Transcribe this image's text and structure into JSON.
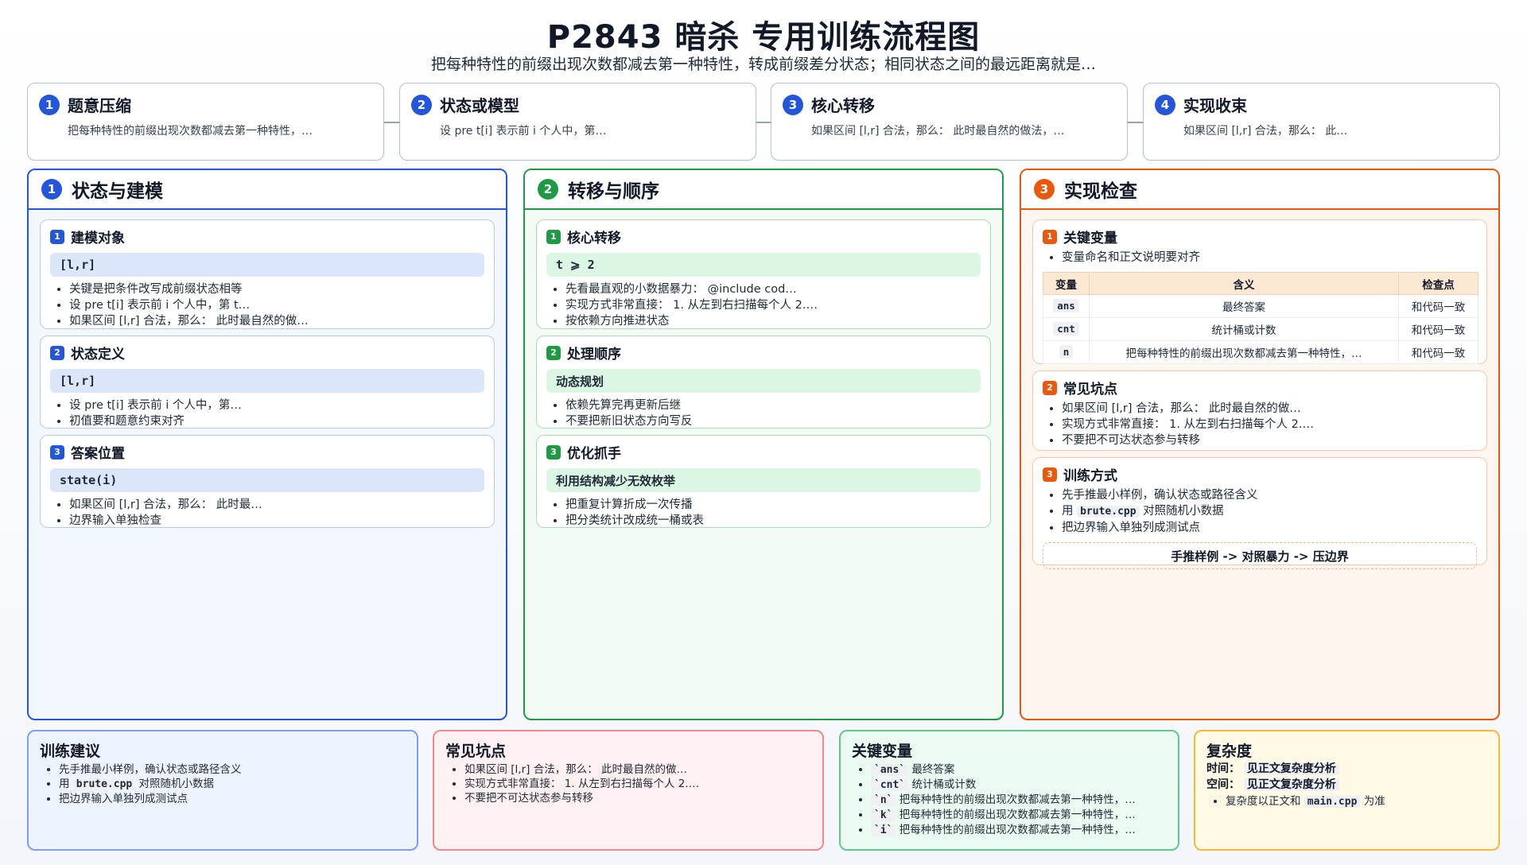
{
  "header": {
    "title": "P2843 暗杀 专用训练流程图",
    "subtitle": "把每种特性的前缀出现次数都减去第一种特性，转成前缀差分状态；相同状态之间的最远距离就是…"
  },
  "flow": [
    {
      "num": "1",
      "title": "题意压缩",
      "desc": "把每种特性的前缀出现次数都减去第一种特性，…"
    },
    {
      "num": "2",
      "title": "状态或模型",
      "desc": "设 pre t[i] 表示前 i 个人中，第…"
    },
    {
      "num": "3",
      "title": "核心转移",
      "desc": "如果区间 [l,r] 合法，那么：  此时最自然的做法，…"
    },
    {
      "num": "4",
      "title": "实现收束",
      "desc": "如果区间 [l,r] 合法，那么：  此…"
    }
  ],
  "columns": {
    "c1": {
      "num": "1",
      "title": "状态与建模",
      "s1": {
        "num": "1",
        "title": "建模对象",
        "pill": "[l,r]",
        "bullets": [
          "关键是把条件改写成前缀状态相等",
          "设 pre t[i] 表示前 i 个人中，第 t…",
          "如果区间 [l,r] 合法，那么：  此时最自然的做…"
        ]
      },
      "s2": {
        "num": "2",
        "title": "状态定义",
        "pill": "[l,r]",
        "bullets": [
          "设 pre t[i] 表示前 i 个人中，第…",
          "初值要和题意约束对齐"
        ]
      },
      "s3": {
        "num": "3",
        "title": "答案位置",
        "pill": "state(i)",
        "bullets": [
          "如果区间 [l,r] 合法，那么：  此时最…",
          "边界输入单独检查"
        ]
      }
    },
    "c2": {
      "num": "2",
      "title": "转移与顺序",
      "s1": {
        "num": "1",
        "title": "核心转移",
        "pill": "t ⩾ 2",
        "bullets": [
          "先看最直观的小数据暴力：  @include cod…",
          "实现方式非常直接：  1. 从左到右扫描每个人 2.…",
          "按依赖方向推进状态"
        ]
      },
      "s2": {
        "num": "2",
        "title": "处理顺序",
        "pill": "动态规划",
        "bullets": [
          "依赖先算完再更新后继",
          "不要把新旧状态方向写反"
        ]
      },
      "s3": {
        "num": "3",
        "title": "优化抓手",
        "pill": "利用结构减少无效枚举",
        "bullets": [
          "把重复计算折成一次传播",
          "把分类统计改成统一桶或表"
        ]
      }
    },
    "c3": {
      "num": "3",
      "title": "实现检查",
      "s1": {
        "num": "1",
        "title": "关键变量",
        "note": "变量命名和正文说明要对齐",
        "table": {
          "headers": [
            "变量",
            "含义",
            "检查点"
          ],
          "rows": [
            [
              "ans",
              "最终答案",
              "和代码一致"
            ],
            [
              "cnt",
              "统计桶或计数",
              "和代码一致"
            ],
            [
              "n",
              "把每种特性的前缀出现次数都减去第一种特性，…",
              "和代码一致"
            ]
          ]
        }
      },
      "s2": {
        "num": "2",
        "title": "常见坑点",
        "bullets": [
          "如果区间 [l,r] 合法，那么：  此时最自然的做…",
          "实现方式非常直接：  1. 从左到右扫描每个人 2.…",
          "不要把不可达状态参与转移"
        ]
      },
      "s3": {
        "num": "3",
        "title": "训练方式",
        "b1": "先手推最小样例，确认状态或路径含义",
        "b2_pre": "用 ",
        "b2_code": "brute.cpp",
        "b2_post": " 对照随机小数据",
        "b3": "把边界输入单独列成测试点",
        "flow_hint": "手推样例 -> 对照暴力 -> 压边界"
      }
    }
  },
  "bottom": {
    "advice": {
      "title": "训练建议",
      "b1": "先手推最小样例，确认状态或路径含义",
      "b2_pre": "用 ",
      "b2_code": "brute.cpp",
      "b2_post": " 对照随机小数据",
      "b3": "把边界输入单独列成测试点"
    },
    "pitfalls": {
      "title": "常见坑点",
      "bullets": [
        "如果区间 [l,r] 合法，那么：  此时最自然的做…",
        "实现方式非常直接：  1. 从左到右扫描每个人 2.…",
        "不要把不可达状态参与转移"
      ]
    },
    "vars": {
      "title": "关键变量",
      "items": [
        {
          "code": "`ans`",
          "text": "最终答案"
        },
        {
          "code": "`cnt`",
          "text": "统计桶或计数"
        },
        {
          "code": "`n`",
          "text": "把每种特性的前缀出现次数都减去第一种特性，…"
        },
        {
          "code": "`k`",
          "text": "把每种特性的前缀出现次数都减去第一种特性，…"
        },
        {
          "code": "`i`",
          "text": "把每种特性的前缀出现次数都减去第一种特性，…"
        }
      ]
    },
    "complexity": {
      "title": "复杂度",
      "time_label": "时间：",
      "time_value": "见正文复杂度分析",
      "space_label": "空间：",
      "space_value": "见正文复杂度分析",
      "note_pre": "复杂度以正文和 ",
      "note_code": "main.cpp",
      "note_post": " 为准"
    }
  },
  "colors": {
    "blue": "#2356d9",
    "green": "#1e9a45",
    "orange": "#ea580c",
    "red": "#f08a8a",
    "amber": "#f5b933"
  }
}
